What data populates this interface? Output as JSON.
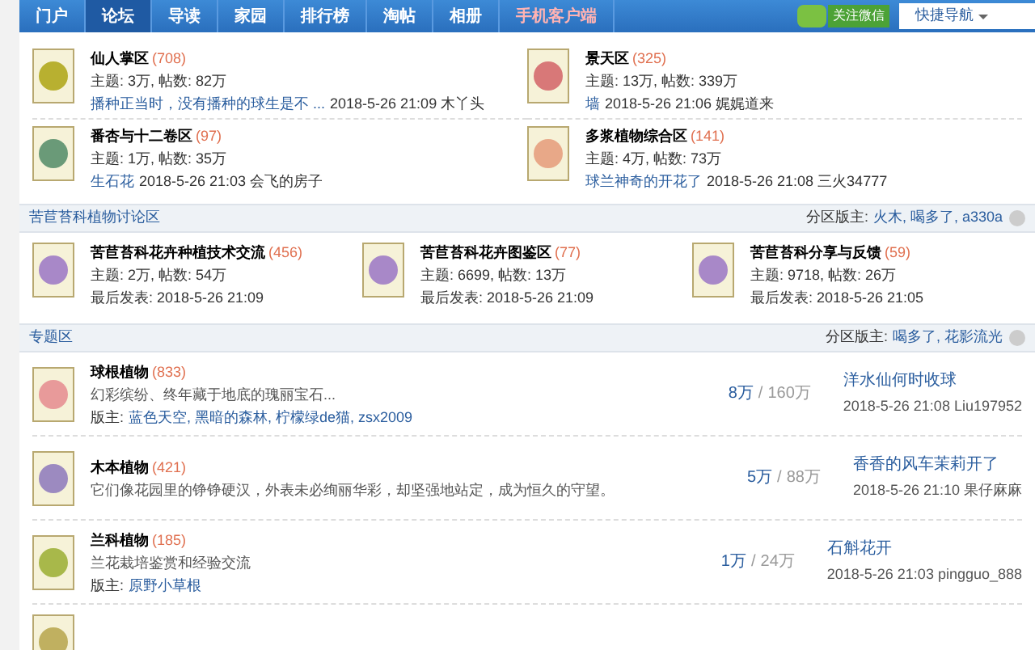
{
  "nav": {
    "items": [
      {
        "label": "门户",
        "selected": false,
        "kind": "normal"
      },
      {
        "label": "论坛",
        "selected": true,
        "kind": "normal"
      },
      {
        "label": "导读",
        "selected": false,
        "kind": "normal"
      },
      {
        "label": "家园",
        "selected": false,
        "kind": "normal"
      },
      {
        "label": "排行榜",
        "selected": false,
        "kind": "normal"
      },
      {
        "label": "淘帖",
        "selected": false,
        "kind": "normal"
      },
      {
        "label": "相册",
        "selected": false,
        "kind": "normal"
      },
      {
        "label": "手机客户端",
        "selected": false,
        "kind": "highlight"
      }
    ],
    "follow_button": "关注微信",
    "quick_nav": "快捷导航"
  },
  "top_forums": [
    {
      "name": "仙人掌区",
      "count": "(708)",
      "stats": "主题: 3万, 帖数: 82万",
      "last_link": "播种正当时，没有播种的球生是不 ...",
      "last_time": "2018-5-26 21:09 木丫头"
    },
    {
      "name": "景天区",
      "count": "(325)",
      "stats": "主题: 13万, 帖数: 339万",
      "last_link": "墙",
      "last_time": "2018-5-26 21:06 娓娓道来"
    },
    {
      "name": "番杏与十二卷区",
      "count": "(97)",
      "stats": "主题: 1万, 帖数: 35万",
      "last_link": "生石花",
      "last_time": "2018-5-26 21:03 会飞的房子"
    },
    {
      "name": "多浆植物综合区",
      "count": "(141)",
      "stats": "主题: 4万, 帖数: 73万",
      "last_link": "球兰神奇的开花了",
      "last_time": "2018-5-26 21:08 三火34777"
    }
  ],
  "sections": [
    {
      "title": "苦苣苔科植物讨论区",
      "moderators_label": "分区版主:",
      "moderators": "火木, 喝多了, a330a",
      "forums": [
        {
          "name": "苦苣苔科花卉种植技术交流",
          "count": "(456)",
          "stats": "主题: 2万, 帖数: 54万",
          "last": "最后发表: 2018-5-26 21:09"
        },
        {
          "name": "苦苣苔科花卉图鉴区",
          "count": "(77)",
          "stats": "主题: 6699, 帖数: 13万",
          "last": "最后发表: 2018-5-26 21:09"
        },
        {
          "name": "苦苣苔科分享与反馈",
          "count": "(59)",
          "stats": "主题: 9718, 帖数: 26万",
          "last": "最后发表: 2018-5-26 21:05"
        }
      ]
    },
    {
      "title": "专题区",
      "moderators_label": "分区版主:",
      "moderators": "喝多了, 花影流光"
    }
  ],
  "topic_forums": [
    {
      "name": "球根植物",
      "count": "(833)",
      "desc": "幻彩缤纷、终年藏于地底的瑰丽宝石...",
      "mods_label": "版主:",
      "mods": "蓝色天空, 黑暗的森林, 柠檬绿de猫, zsx2009",
      "topics": "8万",
      "sep": "/",
      "posts": "160万",
      "last_title": "洋水仙何时收球",
      "last_time": "2018-5-26 21:08 Liu197952"
    },
    {
      "name": "木本植物",
      "count": "(421)",
      "desc": "它们像花园里的铮铮硬汉，外表未必绚丽华彩，却坚强地站定，成为恒久的守望。",
      "topics": "5万",
      "sep": "/",
      "posts": "88万",
      "last_title": "香香的风车茉莉开了",
      "last_time": "2018-5-26 21:10 果仔麻麻"
    },
    {
      "name": "兰科植物",
      "count": "(185)",
      "desc": "兰花栽培鉴赏和经验交流",
      "mods_label": "版主:",
      "mods": "原野小草根",
      "topics": "1万",
      "sep": "/",
      "posts": "24万",
      "last_title": "石斛花开",
      "last_time": "2018-5-26 21:03 pingguo_888"
    }
  ]
}
